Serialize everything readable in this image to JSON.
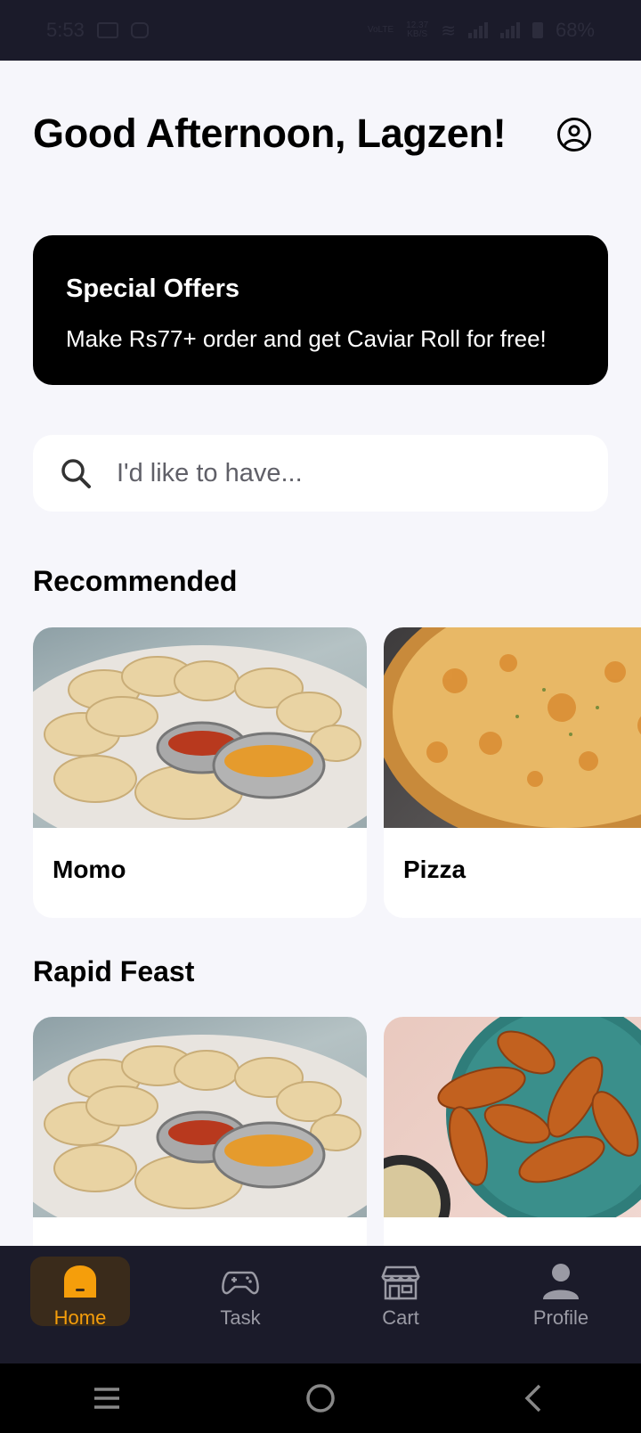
{
  "status_bar": {
    "time": "5:53",
    "net_speed_top": "12.37",
    "net_speed_unit": "KB/S",
    "battery": "68%"
  },
  "header": {
    "greeting": "Good Afternoon, Lagzen!",
    "profile_icon": "user-circle-icon"
  },
  "offers": {
    "title": "Special Offers",
    "text": "Make Rs77+ order and get Caviar Roll for free!"
  },
  "search": {
    "placeholder": "I'd like to have..."
  },
  "recommended": {
    "title": "Recommended",
    "items": [
      {
        "label": "Momo"
      },
      {
        "label": "Pizza"
      }
    ]
  },
  "rapid_feast": {
    "title": "Rapid Feast",
    "items": [
      {
        "label": ""
      },
      {
        "label": ""
      }
    ]
  },
  "bottom_nav": {
    "items": [
      {
        "label": "Home",
        "icon": "home-icon",
        "active": true
      },
      {
        "label": "Task",
        "icon": "gamepad-icon",
        "active": false
      },
      {
        "label": "Cart",
        "icon": "store-icon",
        "active": false
      },
      {
        "label": "Profile",
        "icon": "person-icon",
        "active": false
      }
    ]
  },
  "colors": {
    "accent": "#f59e0b",
    "nav_bg": "#1b1b2a",
    "page_bg": "#f6f6fb"
  }
}
